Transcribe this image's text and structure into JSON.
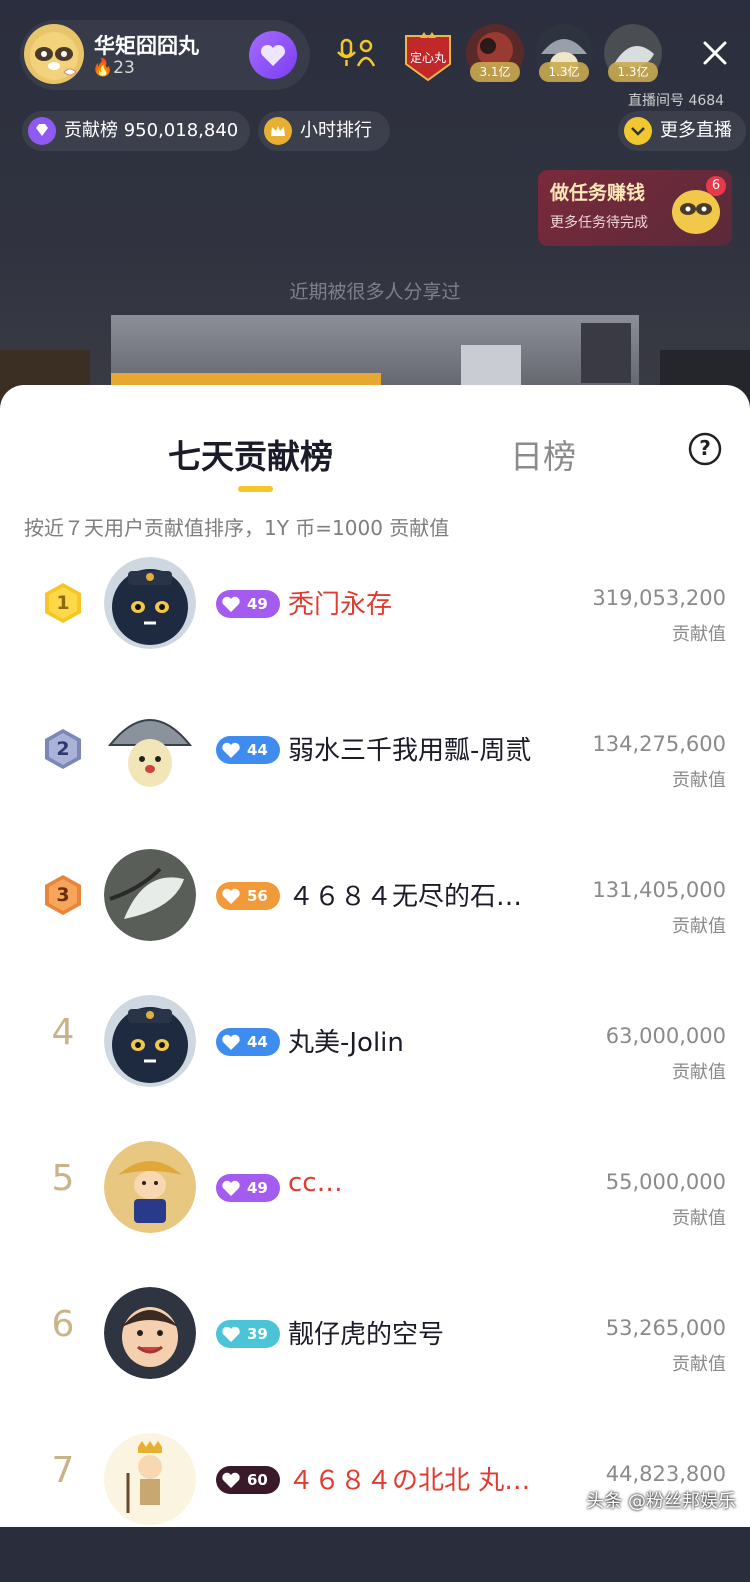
{
  "anchor": {
    "name": "华矩囧囧丸",
    "fans": "23"
  },
  "badge_label": "定心丸",
  "viewers": [
    {
      "tag": "3.1亿"
    },
    {
      "tag": "1.3亿"
    },
    {
      "tag": "1.3亿"
    }
  ],
  "room_id": "直播间号 4684",
  "contribution_pill": {
    "label": "贡献榜 950,018,840"
  },
  "hourly_pill": {
    "label": "小时排行"
  },
  "more_live_pill": {
    "label": "更多直播"
  },
  "task_card": {
    "title": "做任务赚钱",
    "subtitle": "更多任务待完成",
    "badge": "6"
  },
  "share_tip": "近期被很多人分享过",
  "sheet": {
    "tab_active": "七天贡献榜",
    "tab_day": "日榜",
    "help": "?",
    "description": "按近７天用户贡献值排序，1Y 币=1000 贡献值",
    "score_label": "贡献值"
  },
  "rows": [
    {
      "rank": "1",
      "level": "49",
      "name": "秃门永存",
      "score": "319,053,200"
    },
    {
      "rank": "2",
      "level": "44",
      "name": "弱水三千我用瓢-周贰",
      "score": "134,275,600"
    },
    {
      "rank": "3",
      "level": "56",
      "name": "４６８４无尽的石…",
      "score": "131,405,000"
    },
    {
      "rank": "4",
      "level": "44",
      "name": "丸美-Jolin",
      "score": "63,000,000"
    },
    {
      "rank": "5",
      "level": "49",
      "name": "cc…",
      "score": "55,000,000"
    },
    {
      "rank": "6",
      "level": "39",
      "name": "靓仔虎的空号",
      "score": "53,265,000"
    },
    {
      "rank": "7",
      "level": "60",
      "name": "４６８４の北北 丸…",
      "score": "44,823,800"
    }
  ],
  "watermark": "头条 @粉丝邦娱乐",
  "colors": {
    "accent_yellow": "#f6c624",
    "level_purple": "#a45cf0",
    "level_blue": "#3f8cf0",
    "level_orange": "#f29a3a",
    "level_teal": "#4cc4d8",
    "level_dark": "#3a1a2a",
    "red_name": "#e23b2e"
  }
}
